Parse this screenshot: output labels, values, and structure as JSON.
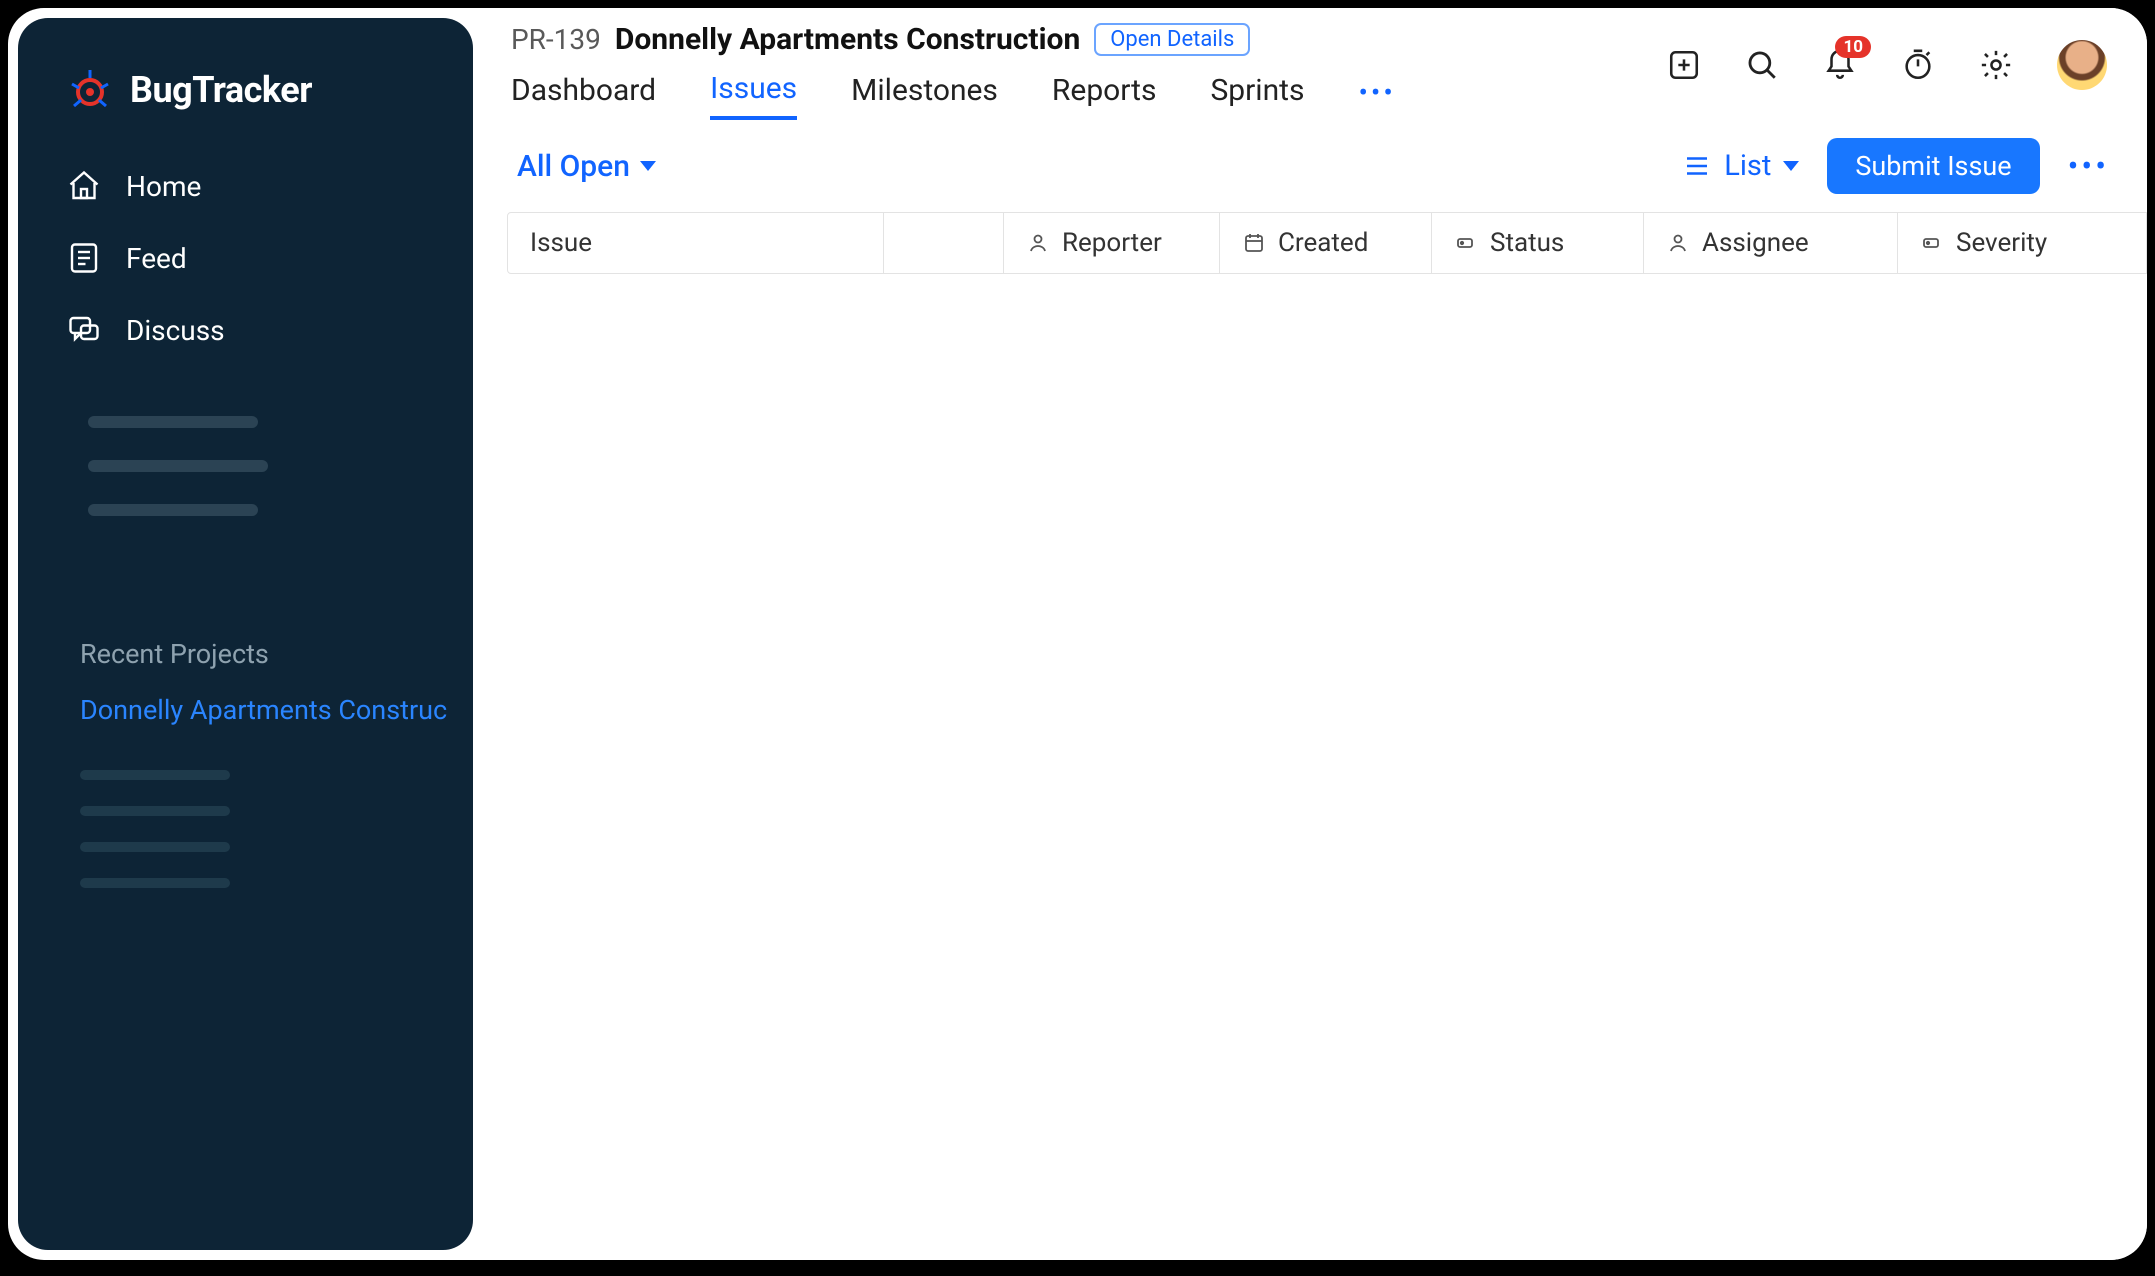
{
  "app": {
    "name": "BugTracker"
  },
  "sidebar": {
    "items": [
      {
        "label": "Home"
      },
      {
        "label": "Feed"
      },
      {
        "label": "Discuss"
      }
    ],
    "recent_heading": "Recent Projects",
    "recent_projects": [
      {
        "label": "Donnelly Apartments Construc"
      }
    ]
  },
  "header": {
    "project_code": "PR-139",
    "project_name": "Donnelly Apartments Construction",
    "open_details": "Open Details",
    "tabs": [
      {
        "label": "Dashboard",
        "active": false
      },
      {
        "label": "Issues",
        "active": true
      },
      {
        "label": "Milestones",
        "active": false
      },
      {
        "label": "Reports",
        "active": false
      },
      {
        "label": "Sprints",
        "active": false
      }
    ],
    "notification_count": "10"
  },
  "filters": {
    "current": "All Open",
    "view_mode": "List",
    "submit_label": "Submit Issue"
  },
  "table": {
    "columns": {
      "issue": "Issue",
      "reporter": "Reporter",
      "created": "Created",
      "status": "Status",
      "assignee": "Assignee",
      "severity": "Severity"
    }
  }
}
